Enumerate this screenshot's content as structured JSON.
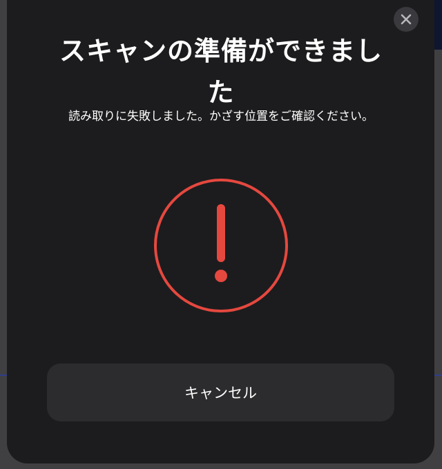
{
  "dialog": {
    "title": "スキャンの準備ができました",
    "message": "読み取りに失敗しました。かざす位置をご確認ください。",
    "cancel_label": "キャンセル"
  },
  "icons": {
    "close": "close-icon",
    "status": "exclamation-circle-icon"
  },
  "colors": {
    "sheet_background": "#1c1c1e",
    "button_background": "#2c2c2e",
    "error_accent": "#e5483f",
    "text": "#ffffff"
  }
}
